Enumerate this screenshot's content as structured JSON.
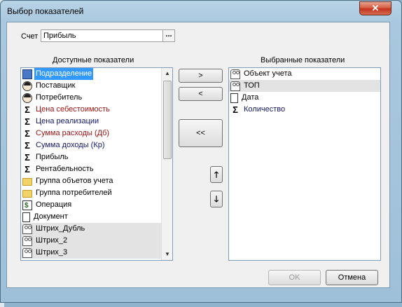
{
  "window": {
    "title": "Выбор показателей",
    "close_label": "✕"
  },
  "account": {
    "label": "Счет",
    "value": "Прибыль",
    "ellipsis": "..."
  },
  "available": {
    "caption": "Доступные показатели",
    "items": [
      {
        "label": "Подразделение",
        "icon": "house-icon",
        "selected": true
      },
      {
        "label": "Поставщик",
        "icon": "person-icon"
      },
      {
        "label": "Потребитель",
        "icon": "person-icon"
      },
      {
        "label": "Цена себестоимость",
        "icon": "sigma-icon",
        "color": "red"
      },
      {
        "label": "Цена реализации",
        "icon": "sigma-icon",
        "color": "blue"
      },
      {
        "label": "Сумма расходы (Дб)",
        "icon": "sigma-icon",
        "color": "red"
      },
      {
        "label": "Сумма доходы (Кр)",
        "icon": "sigma-icon",
        "color": "blue"
      },
      {
        "label": "Прибыль",
        "icon": "sigma-icon"
      },
      {
        "label": "Рентабельность",
        "icon": "sigma-icon"
      },
      {
        "label": "Группа объетов учета",
        "icon": "folder-icon"
      },
      {
        "label": "Группа потребителей",
        "icon": "folder-icon"
      },
      {
        "label": "Операция",
        "icon": "operation-icon"
      },
      {
        "label": "Документ",
        "icon": "document-icon"
      },
      {
        "label": "Штрих_Дубль",
        "icon": "group-icon",
        "grey": true
      },
      {
        "label": "Штрих_2",
        "icon": "group-icon",
        "grey": true
      },
      {
        "label": "Штрих_3",
        "icon": "group-icon",
        "grey": true
      }
    ]
  },
  "selected": {
    "caption": "Выбранные показатели",
    "items": [
      {
        "label": "Объект учета",
        "icon": "group-icon"
      },
      {
        "label": "ТОП",
        "icon": "group-icon",
        "grey": true
      },
      {
        "label": "Дата",
        "icon": "document-icon"
      },
      {
        "label": "Количество",
        "icon": "sigma-icon",
        "color": "blue"
      }
    ]
  },
  "move": {
    "add": ">",
    "remove": "<",
    "remove_all": "<<",
    "up": "🡑",
    "down": "🡓"
  },
  "footer": {
    "ok": "OK",
    "cancel": "Отмена"
  },
  "colors": {
    "selection": "#3399ff",
    "red_text": "#9c1111",
    "blue_text": "#14176a"
  }
}
